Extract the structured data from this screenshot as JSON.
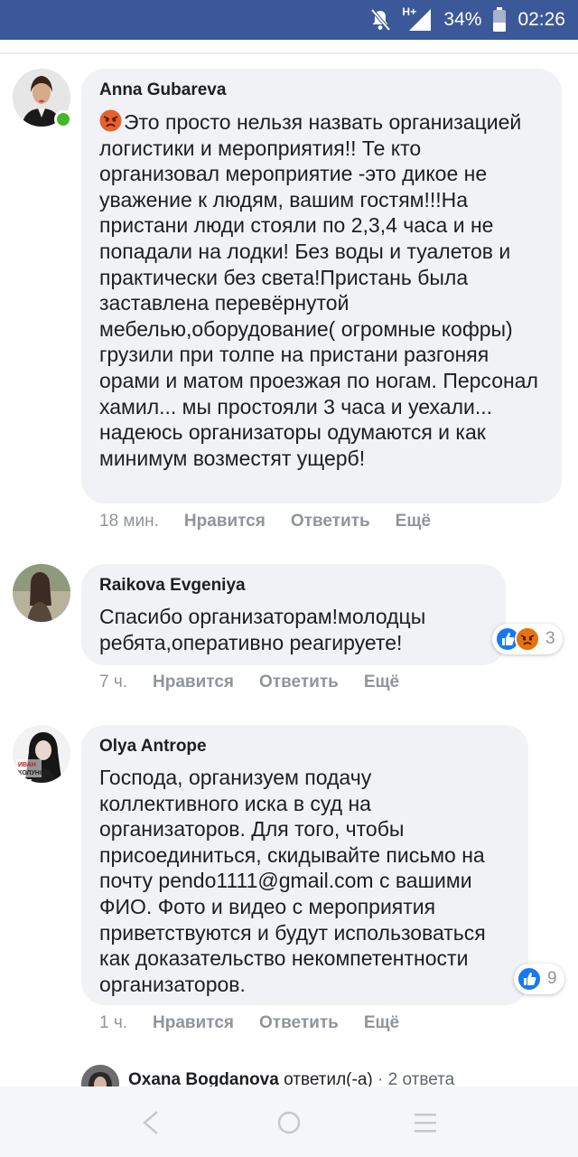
{
  "status_bar": {
    "network": "H+",
    "battery": "34%",
    "time": "02:26",
    "icons": [
      "mute-notifications-icon",
      "signal-icon",
      "battery-icon"
    ]
  },
  "comments": [
    {
      "author": "Anna Gubareva",
      "text_emoji": "angry-face",
      "text": "Это просто нельзя назвать организацией логистики и мероприятия!! Те кто организовал мероприятие -это дикое не уважение к людям, вашим гостям!!!На пристани люди стояли по 2,3,4 часа и не попадали на лодки! Без воды и туалетов и практически без света!Пристань была заставлена перевёрнутой мебелью,оборудование( огромные кофры) грузили при толпе на пристани разгоняя орами и матом проезжая по ногам. Персонал хамил... мы простояли 3 часа и уехали... надеюсь организаторы одумаются и как минимум возместят ущерб!",
      "time": "18 мин.",
      "online": true
    },
    {
      "author": "Raikova Evgeniya",
      "text": "Спасибо организаторам!молодцы ребята,оперативно реагируете!",
      "time": "7 ч.",
      "reactions": {
        "types": [
          "like",
          "angry"
        ],
        "count": "3"
      }
    },
    {
      "author": "Olya Antrope",
      "text": "Господа, организуем подачу коллективного иска в суд на организаторов. Для того, чтобы присоединиться, скидывайте письмо на почту pendo1111@gmail.com с вашими ФИО. Фото и видео с мероприятия приветствуются и будут использоваться как доказательство некомпетентности организаторов.",
      "time": "1 ч.",
      "reactions": {
        "types": [
          "like"
        ],
        "count": "9"
      },
      "avatar_text": "ИВАН КОЛУНОВ"
    }
  ],
  "actions": {
    "like": "Нравится",
    "reply": "Ответить",
    "more": "Ещё"
  },
  "reply_preview": {
    "author": "Oxana Bogdanova",
    "action": "ответил(-а)",
    "separator": "·",
    "count": "2 ответа"
  },
  "nav": {
    "icons": [
      "back-icon",
      "home-icon",
      "menu-icon"
    ]
  }
}
